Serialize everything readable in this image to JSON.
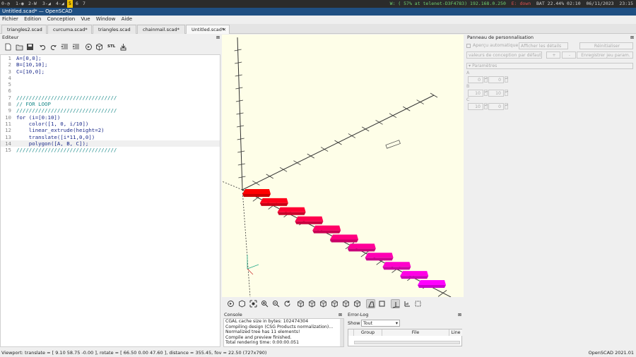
{
  "system_bar": {
    "workspaces": [
      "0-◔",
      "1-◉",
      "2-W",
      "3-◢",
      "4-◢",
      "5",
      "6",
      "7"
    ],
    "active_workspace": "5",
    "wifi": "W: ( 57% at telenet-D3F4783) 192.168.0.250",
    "eth": "E: down",
    "battery": "BAT 22.44% 02:10",
    "date": "06/11/2023",
    "time": "23:15"
  },
  "window": {
    "title": "Untitled.scad* — OpenSCAD"
  },
  "menu": [
    "Fichier",
    "Edition",
    "Conception",
    "Vue",
    "Window",
    "Aide"
  ],
  "tabs": [
    {
      "label": "triangles2.scad"
    },
    {
      "label": "curcuma.scad*"
    },
    {
      "label": "triangles.scad"
    },
    {
      "label": "chainmail.scad*"
    },
    {
      "label": "Untitled.scad*",
      "active": true
    }
  ],
  "editor": {
    "title": "Editeur",
    "toolbar": [
      "new-file-icon",
      "open-file-icon",
      "save-icon",
      "undo-icon",
      "redo-icon",
      "unindent-icon",
      "indent-icon",
      "preview-icon",
      "render-icon",
      "export-stl-icon",
      "send-to-print-icon"
    ],
    "stl_label": "STL",
    "current_line": 14,
    "lines": [
      {
        "n": "1",
        "text": "A=[0,0];",
        "kind": "code"
      },
      {
        "n": "2",
        "text": "B=[10,10];",
        "kind": "code"
      },
      {
        "n": "3",
        "text": "C=[10,0];",
        "kind": "code"
      },
      {
        "n": "4",
        "text": "",
        "kind": "code"
      },
      {
        "n": "5",
        "text": "",
        "kind": "code"
      },
      {
        "n": "6",
        "text": "",
        "kind": "code"
      },
      {
        "n": "7",
        "text": "////////////////////////////////",
        "kind": "comment"
      },
      {
        "n": "8",
        "text": "// FOR LOOP",
        "kind": "comment"
      },
      {
        "n": "9",
        "text": "////////////////////////////////",
        "kind": "comment"
      },
      {
        "n": "10",
        "text": "for (i=[0:10])",
        "kind": "code"
      },
      {
        "n": "11",
        "text": "    color([1, 0, i/10])",
        "kind": "code"
      },
      {
        "n": "12",
        "text": "    linear_extrude(height=2)",
        "kind": "code"
      },
      {
        "n": "13",
        "text": "    translate([i*11,0,0])",
        "kind": "code"
      },
      {
        "n": "14",
        "text": "    polygon([A, B, C]);",
        "kind": "code"
      },
      {
        "n": "15",
        "text": "////////////////////////////////",
        "kind": "comment"
      }
    ]
  },
  "viewport": {
    "background": "#fefee8",
    "object_count": 11,
    "color_start": "#ff0000",
    "color_end": "#ff00ff"
  },
  "view_toolbar": [
    "preview-icon",
    "render-icon",
    "view-all-icon",
    "zoom-in-icon",
    "zoom-out-icon",
    "reset-view-icon",
    "view-right-icon",
    "view-top-icon",
    "view-bottom-icon",
    "view-left-icon",
    "view-front-icon",
    "view-back-icon",
    "perspective-icon",
    "orthogonal-icon",
    "show-axes-icon",
    "show-scale-icon",
    "show-edges-icon"
  ],
  "console": {
    "title": "Console",
    "lines": [
      "CGAL cache size in bytes: 102474304",
      "Compiling design (CSG Products normalization)...",
      "Normalized tree has 11 elements!",
      "Compile and preview finished.",
      "Total rendering time: 0:00:00.051"
    ]
  },
  "error_log": {
    "title": "Error-Log",
    "show_label": "Show",
    "filter_value": "Tout",
    "columns": [
      "Group",
      "File",
      "Line"
    ]
  },
  "customizer": {
    "title": "Panneau de personnalisation",
    "auto_preview": "Aperçu automatique",
    "details_select": "Afficher les détails",
    "reset_button": "Réinitialiser",
    "preset_select": "valeurs de conception par défaut",
    "add_button": "+",
    "remove_button": "-",
    "save_button": "Enregistrer jeu param.",
    "section": "Paramètres",
    "params": [
      {
        "name": "A",
        "values": [
          "0",
          "0"
        ]
      },
      {
        "name": "B",
        "values": [
          "10",
          "10"
        ]
      },
      {
        "name": "C",
        "values": [
          "10",
          "0"
        ]
      }
    ]
  },
  "status_bar": {
    "viewport_info": "Viewport: translate = [ 9.10 58.75 -0.00 ], rotate = [ 66.50 0.00 47.60 ], distance = 355.45, fov = 22.50 (727x790)",
    "version": "OpenSCAD 2021.01"
  }
}
